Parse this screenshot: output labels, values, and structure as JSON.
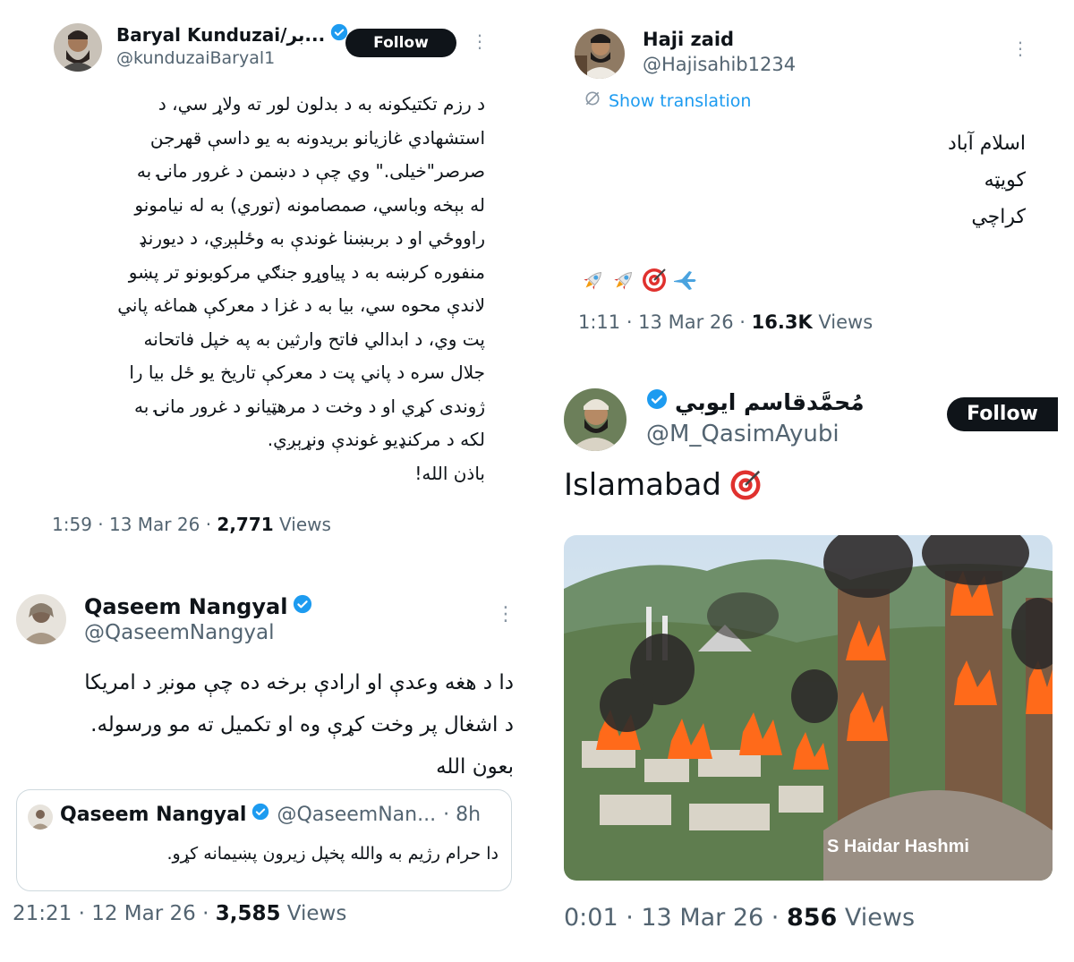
{
  "tweets": {
    "baryal": {
      "name": "Baryal Kunduzai/بر...",
      "handle": "@kunduzaiBaryal1",
      "follow": "Follow",
      "lines": [
        "د رزم تکتیکونه به د بدلون لور ته ولاړ سي، د",
        "استشهادي غازیانو بریدونه به یو داسې قهرجن",
        "صرصر\"خیلی.\" وي چې د دښمن د غرور مانۍ به",
        "له بېخه وباسي، صمصامونه (توري) به له نیامونو",
        "راووځي او د بربښنا غوندې به وځلېږي، د دیورنډ",
        "منفوره کرښه به د پیاوړو جنګي مرکوبونو تر پښو",
        "لاندې محوه سي، بیا به د غزا د معرکې هماغه پاني",
        "پت وي، د ابدالي فاتح وارثین به په خپل فاتحانه",
        "جلال سره د پاني پت د معرکې تاریخ یو ځل بیا را",
        "ژوندی کړي او د وخت د مرهټیانو د غرور مانۍ به",
        "لکه د مرکنډیو غوندې ونړېږي.",
        "باذن الله!"
      ],
      "time": "1:59 · 13 Mar 26 · ",
      "views_count": "2,771",
      "views_label": " Views"
    },
    "haji": {
      "name": "Haji zaid",
      "handle": "@Hajisahib1234",
      "show_translation": "Show translation",
      "lines": [
        "اسلام آباد",
        "کویټه",
        "کراچي"
      ],
      "emojis": [
        "rocket",
        "rocket",
        "target",
        "airplane"
      ],
      "time": "1:11 · 13 Mar 26 · ",
      "views_count": "16.3K",
      "views_label": " Views"
    },
    "qaseem": {
      "name": "Qaseem Nangyal",
      "handle": "@QaseemNangyal",
      "lines": [
        "دا د هغه وعدې او ارادې برخه ده چې مونږ د امریکا",
        "د اشغال پر وخت کړې وه او تکمیل ته مو ورسوله.",
        "بعون الله"
      ],
      "quote": {
        "name": "Qaseem Nangyal",
        "handle": "@QaseemNan...",
        "age": "· 8h",
        "text": "دا حرام رژیم به والله پخپل زیرون پښیمانه کړو."
      },
      "time": "21:21 · 12 Mar 26 · ",
      "views_count": "3,585",
      "views_label": " Views"
    },
    "qasim": {
      "name": "مُحمَّدقاسم ایوبي",
      "handle": "@M_QasimAyubi",
      "follow": "Follow",
      "text": "Islamabad",
      "emoji": "target",
      "image_watermark": "S Haidar Hashmi",
      "time": "0:01 · 13 Mar 26 · ",
      "views_count": "856",
      "views_label": " Views"
    }
  },
  "colors": {
    "text": "#0f1419",
    "muted": "#536471",
    "link": "#1d9bf0",
    "verified": "#1d9bf0",
    "follow_bg": "#0f1419"
  }
}
